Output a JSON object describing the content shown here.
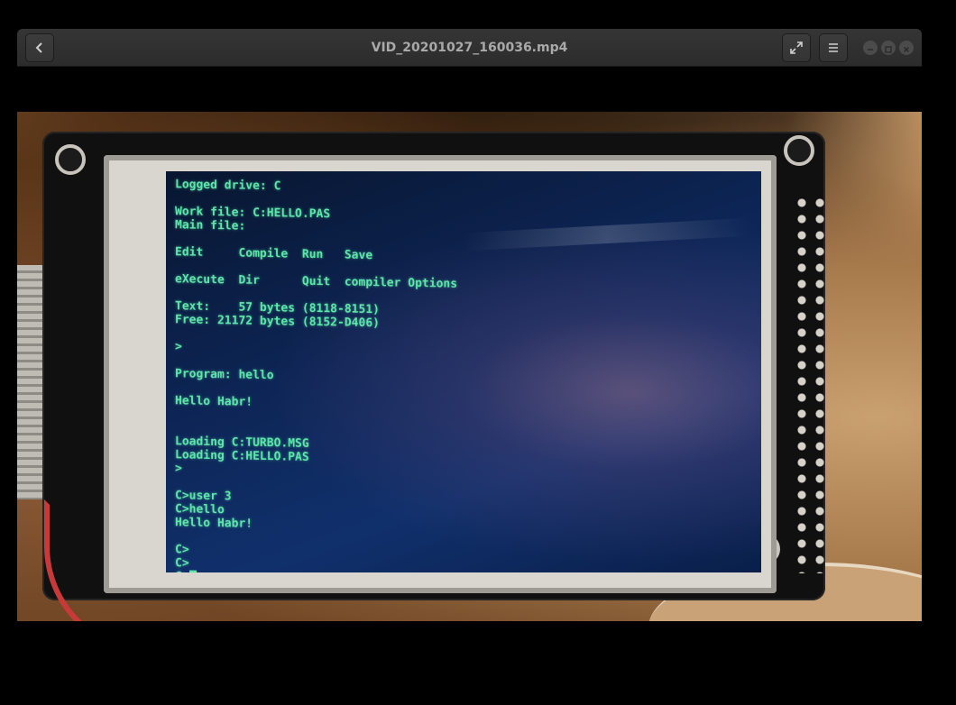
{
  "window": {
    "title": "VID_20201027_160036.mp4",
    "controls": {
      "back_icon": "chevron-left-icon",
      "fullscreen_icon": "expand-icon",
      "menu_icon": "hamburger-menu-icon",
      "minimize_icon": "minimize-icon",
      "maximize_icon": "maximize-icon",
      "close_icon": "close-icon"
    }
  },
  "terminal": {
    "lines": [
      "Logged drive: C",
      "",
      "Work file: C:HELLO.PAS",
      "Main file:",
      "",
      "Edit     Compile  Run   Save",
      "",
      "eXecute  Dir      Quit  compiler Options",
      "",
      "Text:    57 bytes (8118-8151)",
      "Free: 21172 bytes (8152-D406)",
      "",
      ">",
      "",
      "Program: hello",
      "",
      "Hello Habr!",
      "",
      "",
      "Loading C:TURBO.MSG",
      "Loading C:HELLO.PAS",
      ">",
      "",
      "C>user 3",
      "C>hello",
      "Hello Habr!",
      "",
      "C>",
      "C>",
      "C>"
    ],
    "text_color": "#5de6a9"
  }
}
